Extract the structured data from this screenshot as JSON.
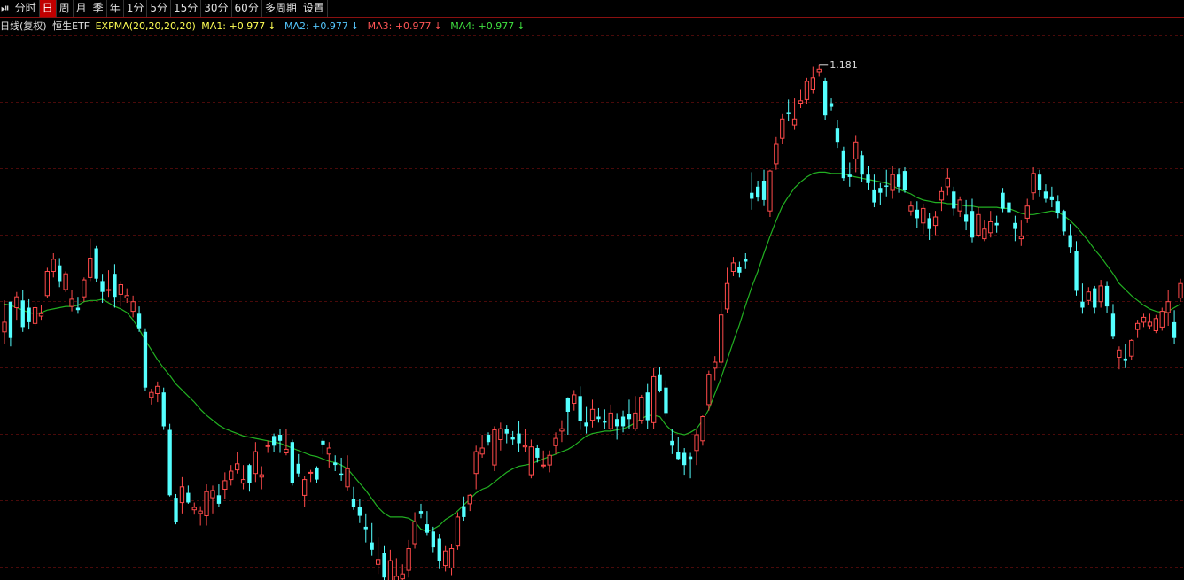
{
  "toolbar": {
    "items": [
      {
        "label": "⏯"
      },
      {
        "label": "分时"
      },
      {
        "label": "日"
      },
      {
        "label": "周"
      },
      {
        "label": "月"
      },
      {
        "label": "季"
      },
      {
        "label": "年"
      },
      {
        "label": "1分"
      },
      {
        "label": "5分"
      },
      {
        "label": "15分"
      },
      {
        "label": "30分"
      },
      {
        "label": "60分"
      },
      {
        "label": "多周期"
      },
      {
        "label": "设置"
      }
    ],
    "active_index": 2
  },
  "info": {
    "period": "日线(复权)",
    "symbol": "恒生ETF",
    "indicator": "EXPMA(20,20,20,20)",
    "ma1": "MA1: +0.977",
    "ma2": "MA2: +0.977",
    "ma3": "MA3: +0.977",
    "ma4": "MA4: +0.977",
    "arrow": "↓"
  },
  "colors": {
    "up": "#ff4a4a",
    "down": "#54ffff",
    "ema": "#22b022",
    "grid": "#4a0a0a",
    "ma1": "#ffff55",
    "ma2": "#55c8ff",
    "ma3": "#ff5555",
    "ma4": "#40e040",
    "indicator": "#ffff55"
  },
  "chart_data": {
    "type": "candlestick",
    "title": "",
    "ylim": [
      0.755,
      1.205
    ],
    "max_label": "1.181",
    "candles": [
      [
        0.96,
        0.986,
        0.95,
        0.968
      ],
      [
        0.985,
        0.985,
        0.948,
        0.955
      ],
      [
        0.98,
        0.993,
        0.97,
        0.989
      ],
      [
        0.986,
        0.995,
        0.96,
        0.964
      ],
      [
        0.98,
        0.987,
        0.962,
        0.968
      ],
      [
        0.967,
        0.985,
        0.965,
        0.98
      ],
      [
        0.973,
        0.982,
        0.97,
        0.975
      ],
      [
        0.99,
        1.013,
        0.988,
        1.01
      ],
      [
        1.01,
        1.025,
        1.005,
        1.02
      ],
      [
        1.015,
        1.021,
        0.997,
        1.002
      ],
      [
        0.995,
        1.01,
        0.993,
        1.008
      ],
      [
        0.981,
        0.995,
        0.977,
        0.987
      ],
      [
        0.98,
        0.989,
        0.975,
        0.978
      ],
      [
        0.989,
        1.005,
        0.985,
        1.003
      ],
      [
        1.005,
        1.037,
        1.002,
        1.021
      ],
      [
        1.029,
        1.031,
        1.001,
        1.004
      ],
      [
        1.002,
        1.008,
        0.984,
        0.993
      ],
      [
        0.995,
        1.011,
        0.989,
        0.995
      ],
      [
        1.008,
        1.016,
        0.98,
        0.989
      ],
      [
        0.991,
        1.002,
        0.981,
        0.999
      ],
      [
        0.988,
        0.996,
        0.984,
        0.99
      ],
      [
        0.977,
        0.99,
        0.972,
        0.985
      ],
      [
        0.975,
        0.981,
        0.96,
        0.963
      ],
      [
        0.96,
        0.963,
        0.911,
        0.914
      ],
      [
        0.906,
        0.913,
        0.9,
        0.91
      ],
      [
        0.909,
        0.919,
        0.902,
        0.915
      ],
      [
        0.91,
        0.914,
        0.879,
        0.882
      ],
      [
        0.879,
        0.884,
        0.824,
        0.825
      ],
      [
        0.823,
        0.826,
        0.801,
        0.803
      ],
      [
        0.819,
        0.84,
        0.81,
        0.832
      ],
      [
        0.827,
        0.833,
        0.818,
        0.819
      ],
      [
        0.813,
        0.819,
        0.809,
        0.815
      ],
      [
        0.81,
        0.816,
        0.8,
        0.812
      ],
      [
        0.808,
        0.834,
        0.8,
        0.828
      ],
      [
        0.823,
        0.833,
        0.81,
        0.829
      ],
      [
        0.825,
        0.834,
        0.815,
        0.818
      ],
      [
        0.83,
        0.844,
        0.822,
        0.837
      ],
      [
        0.838,
        0.85,
        0.833,
        0.845
      ],
      [
        0.846,
        0.861,
        0.843,
        0.851
      ],
      [
        0.835,
        0.85,
        0.83,
        0.838
      ],
      [
        0.85,
        0.851,
        0.828,
        0.835
      ],
      [
        0.843,
        0.869,
        0.836,
        0.861
      ],
      [
        0.84,
        0.849,
        0.83,
        0.842
      ],
      [
        0.866,
        0.87,
        0.86,
        0.866
      ],
      [
        0.874,
        0.876,
        0.861,
        0.866
      ],
      [
        0.875,
        0.88,
        0.86,
        0.87
      ],
      [
        0.86,
        0.88,
        0.858,
        0.863
      ],
      [
        0.869,
        0.871,
        0.833,
        0.835
      ],
      [
        0.851,
        0.859,
        0.84,
        0.843
      ],
      [
        0.825,
        0.841,
        0.815,
        0.838
      ],
      [
        0.844,
        0.846,
        0.836,
        0.844
      ],
      [
        0.848,
        0.849,
        0.835,
        0.838
      ],
      [
        0.87,
        0.872,
        0.859,
        0.867
      ],
      [
        0.859,
        0.869,
        0.848,
        0.864
      ],
      [
        0.852,
        0.858,
        0.845,
        0.85
      ],
      [
        0.843,
        0.856,
        0.837,
        0.842
      ],
      [
        0.832,
        0.858,
        0.829,
        0.847
      ],
      [
        0.822,
        0.832,
        0.813,
        0.815
      ],
      [
        0.815,
        0.822,
        0.802,
        0.808
      ],
      [
        0.799,
        0.81,
        0.786,
        0.797
      ],
      [
        0.786,
        0.802,
        0.775,
        0.78
      ],
      [
        0.768,
        0.79,
        0.76,
        0.772
      ],
      [
        0.777,
        0.783,
        0.748,
        0.757
      ],
      [
        0.752,
        0.78,
        0.745,
        0.771
      ],
      [
        0.746,
        0.773,
        0.74,
        0.758
      ],
      [
        0.756,
        0.768,
        0.745,
        0.76
      ],
      [
        0.763,
        0.788,
        0.757,
        0.781
      ],
      [
        0.785,
        0.811,
        0.781,
        0.803
      ],
      [
        0.812,
        0.818,
        0.806,
        0.81
      ],
      [
        0.801,
        0.812,
        0.792,
        0.794
      ],
      [
        0.795,
        0.799,
        0.778,
        0.782
      ],
      [
        0.789,
        0.793,
        0.764,
        0.771
      ],
      [
        0.767,
        0.783,
        0.762,
        0.779
      ],
      [
        0.765,
        0.785,
        0.759,
        0.781
      ],
      [
        0.783,
        0.811,
        0.78,
        0.807
      ],
      [
        0.816,
        0.824,
        0.804,
        0.807
      ],
      [
        0.818,
        0.826,
        0.812,
        0.825
      ],
      [
        0.843,
        0.866,
        0.83,
        0.861
      ],
      [
        0.859,
        0.875,
        0.856,
        0.864
      ],
      [
        0.875,
        0.877,
        0.866,
        0.869
      ],
      [
        0.85,
        0.882,
        0.845,
        0.879
      ],
      [
        0.871,
        0.885,
        0.862,
        0.88
      ],
      [
        0.88,
        0.883,
        0.868,
        0.876
      ],
      [
        0.873,
        0.878,
        0.867,
        0.871
      ],
      [
        0.876,
        0.886,
        0.861,
        0.868
      ],
      [
        0.865,
        0.88,
        0.861,
        0.866
      ],
      [
        0.842,
        0.871,
        0.839,
        0.865
      ],
      [
        0.864,
        0.867,
        0.852,
        0.856
      ],
      [
        0.85,
        0.862,
        0.847,
        0.85
      ],
      [
        0.85,
        0.862,
        0.844,
        0.858
      ],
      [
        0.866,
        0.877,
        0.859,
        0.872
      ],
      [
        0.878,
        0.887,
        0.869,
        0.88
      ],
      [
        0.905,
        0.906,
        0.875,
        0.894
      ],
      [
        0.901,
        0.912,
        0.895,
        0.908
      ],
      [
        0.907,
        0.915,
        0.879,
        0.886
      ],
      [
        0.885,
        0.898,
        0.876,
        0.882
      ],
      [
        0.887,
        0.904,
        0.881,
        0.896
      ],
      [
        0.89,
        0.897,
        0.885,
        0.888
      ],
      [
        0.886,
        0.896,
        0.88,
        0.885
      ],
      [
        0.88,
        0.9,
        0.878,
        0.893
      ],
      [
        0.888,
        0.893,
        0.871,
        0.882
      ],
      [
        0.89,
        0.895,
        0.877,
        0.882
      ],
      [
        0.892,
        0.904,
        0.88,
        0.888
      ],
      [
        0.88,
        0.907,
        0.878,
        0.893
      ],
      [
        0.887,
        0.908,
        0.884,
        0.906
      ],
      [
        0.91,
        0.917,
        0.88,
        0.887
      ],
      [
        0.885,
        0.93,
        0.88,
        0.923
      ],
      [
        0.925,
        0.931,
        0.91,
        0.911
      ],
      [
        0.914,
        0.92,
        0.89,
        0.893
      ],
      [
        0.87,
        0.88,
        0.859,
        0.866
      ],
      [
        0.861,
        0.873,
        0.854,
        0.855
      ],
      [
        0.86,
        0.864,
        0.842,
        0.85
      ],
      [
        0.857,
        0.86,
        0.839,
        0.855
      ],
      [
        0.862,
        0.879,
        0.85,
        0.875
      ],
      [
        0.87,
        0.891,
        0.866,
        0.89
      ],
      [
        0.9,
        0.928,
        0.895,
        0.925
      ],
      [
        0.93,
        0.94,
        0.92,
        0.935
      ],
      [
        0.935,
        0.985,
        0.932,
        0.974
      ],
      [
        0.979,
        1.013,
        0.976,
        1.0
      ],
      [
        1.01,
        1.022,
        1.006,
        1.017
      ],
      [
        1.014,
        1.018,
        1.005,
        1.009
      ],
      [
        1.02,
        1.025,
        1.012,
        1.018
      ],
      [
        1.075,
        1.092,
        1.061,
        1.07
      ],
      [
        1.08,
        1.085,
        1.068,
        1.071
      ],
      [
        1.085,
        1.094,
        1.064,
        1.069
      ],
      [
        1.06,
        1.094,
        1.055,
        1.093
      ],
      [
        1.099,
        1.121,
        1.094,
        1.115
      ],
      [
        1.12,
        1.14,
        1.115,
        1.136
      ],
      [
        1.141,
        1.152,
        1.134,
        1.14
      ],
      [
        1.131,
        1.153,
        1.127,
        1.136
      ],
      [
        1.149,
        1.16,
        1.145,
        1.151
      ],
      [
        1.152,
        1.17,
        1.148,
        1.167
      ],
      [
        1.16,
        1.179,
        1.157,
        1.17
      ],
      [
        1.175,
        1.181,
        1.171,
        1.177
      ],
      [
        1.167,
        1.17,
        1.135,
        1.139
      ],
      [
        1.149,
        1.153,
        1.143,
        1.146
      ],
      [
        1.128,
        1.135,
        1.112,
        1.117
      ],
      [
        1.11,
        1.113,
        1.085,
        1.087
      ],
      [
        1.09,
        1.1,
        1.08,
        1.088
      ],
      [
        1.103,
        1.122,
        1.092,
        1.117
      ],
      [
        1.106,
        1.11,
        1.084,
        1.09
      ],
      [
        1.09,
        1.097,
        1.077,
        1.083
      ],
      [
        1.077,
        1.09,
        1.063,
        1.067
      ],
      [
        1.079,
        1.083,
        1.065,
        1.075
      ],
      [
        1.081,
        1.094,
        1.072,
        1.08
      ],
      [
        1.077,
        1.097,
        1.07,
        1.09
      ],
      [
        1.09,
        1.095,
        1.075,
        1.08
      ],
      [
        1.093,
        1.096,
        1.075,
        1.077
      ],
      [
        1.06,
        1.068,
        1.056,
        1.064
      ],
      [
        1.061,
        1.068,
        1.046,
        1.054
      ],
      [
        1.05,
        1.066,
        1.041,
        1.062
      ],
      [
        1.054,
        1.058,
        1.036,
        1.045
      ],
      [
        1.048,
        1.06,
        1.04,
        1.055
      ],
      [
        1.069,
        1.08,
        1.06,
        1.076
      ],
      [
        1.08,
        1.095,
        1.073,
        1.087
      ],
      [
        1.076,
        1.08,
        1.056,
        1.062
      ],
      [
        1.06,
        1.072,
        1.055,
        1.069
      ],
      [
        1.057,
        1.069,
        1.044,
        1.051
      ],
      [
        1.06,
        1.07,
        1.034,
        1.038
      ],
      [
        1.04,
        1.063,
        1.038,
        1.057
      ],
      [
        1.037,
        1.052,
        1.035,
        1.045
      ],
      [
        1.042,
        1.06,
        1.038,
        1.051
      ],
      [
        1.05,
        1.056,
        1.042,
        1.048
      ],
      [
        1.075,
        1.079,
        1.059,
        1.062
      ],
      [
        1.067,
        1.071,
        1.055,
        1.059
      ],
      [
        1.05,
        1.056,
        1.035,
        1.045
      ],
      [
        1.037,
        1.052,
        1.031,
        1.039
      ],
      [
        1.054,
        1.07,
        1.05,
        1.064
      ],
      [
        1.075,
        1.096,
        1.069,
        1.091
      ],
      [
        1.09,
        1.094,
        1.072,
        1.077
      ],
      [
        1.076,
        1.082,
        1.067,
        1.07
      ],
      [
        1.072,
        1.08,
        1.063,
        1.069
      ],
      [
        1.068,
        1.073,
        1.054,
        1.058
      ],
      [
        1.06,
        1.061,
        1.04,
        1.043
      ],
      [
        1.04,
        1.049,
        1.025,
        1.03
      ],
      [
        1.027,
        1.035,
        0.99,
        0.994
      ],
      [
        0.985,
        1.0,
        0.975,
        0.98
      ],
      [
        0.986,
        0.997,
        0.982,
        0.993
      ],
      [
        0.996,
        0.998,
        0.975,
        0.98
      ],
      [
        0.985,
        1.003,
        0.98,
        0.998
      ],
      [
        0.998,
        1.002,
        0.976,
        0.981
      ],
      [
        0.975,
        0.983,
        0.954,
        0.956
      ],
      [
        0.939,
        0.948,
        0.929,
        0.945
      ],
      [
        0.938,
        0.95,
        0.93,
        0.936
      ],
      [
        0.94,
        0.954,
        0.937,
        0.953
      ],
      [
        0.962,
        0.97,
        0.955,
        0.967
      ],
      [
        0.968,
        0.975,
        0.964,
        0.972
      ],
      [
        0.965,
        0.975,
        0.962,
        0.968
      ],
      [
        0.961,
        0.974,
        0.959,
        0.971
      ],
      [
        0.964,
        0.98,
        0.961,
        0.977
      ],
      [
        0.976,
        0.995,
        0.965,
        0.985
      ],
      [
        0.968,
        0.978,
        0.95,
        0.955
      ],
      [
        0.988,
        1.004,
        0.985,
        1.0
      ]
    ],
    "ema": [
      0.983,
      0.982,
      0.98,
      0.978,
      0.976,
      0.975,
      0.976,
      0.978,
      0.979,
      0.98,
      0.981,
      0.981,
      0.982,
      0.985,
      0.986,
      0.986,
      0.987,
      0.984,
      0.981,
      0.979,
      0.976,
      0.97,
      0.962,
      0.953,
      0.945,
      0.937,
      0.93,
      0.924,
      0.917,
      0.912,
      0.907,
      0.902,
      0.896,
      0.891,
      0.887,
      0.883,
      0.88,
      0.878,
      0.876,
      0.874,
      0.873,
      0.872,
      0.871,
      0.87,
      0.869,
      0.868,
      0.866,
      0.864,
      0.862,
      0.86,
      0.858,
      0.857,
      0.855,
      0.853,
      0.852,
      0.85,
      0.847,
      0.841,
      0.835,
      0.829,
      0.822,
      0.815,
      0.81,
      0.807,
      0.807,
      0.807,
      0.806,
      0.803,
      0.797,
      0.795,
      0.797,
      0.8,
      0.805,
      0.808,
      0.812,
      0.817,
      0.822,
      0.827,
      0.83,
      0.832,
      0.836,
      0.84,
      0.844,
      0.847,
      0.849,
      0.85,
      0.851,
      0.853,
      0.855,
      0.857,
      0.859,
      0.861,
      0.863,
      0.866,
      0.87,
      0.874,
      0.876,
      0.877,
      0.878,
      0.878,
      0.879,
      0.88,
      0.882,
      0.885,
      0.888,
      0.891,
      0.891,
      0.89,
      0.883,
      0.878,
      0.876,
      0.875,
      0.877,
      0.88,
      0.887,
      0.896,
      0.909,
      0.922,
      0.937,
      0.952,
      0.966,
      0.982,
      0.997,
      1.01,
      1.025,
      1.039,
      1.052,
      1.064,
      1.072,
      1.079,
      1.084,
      1.088,
      1.091,
      1.092,
      1.092,
      1.091,
      1.091,
      1.091,
      1.089,
      1.088,
      1.087,
      1.086,
      1.085,
      1.084,
      1.083,
      1.081,
      1.078,
      1.076,
      1.074,
      1.071,
      1.069,
      1.068,
      1.067,
      1.067,
      1.066,
      1.066,
      1.065,
      1.064,
      1.064,
      1.063,
      1.063,
      1.063,
      1.063,
      1.062,
      1.062,
      1.06,
      1.058,
      1.057,
      1.057,
      1.058,
      1.059,
      1.06,
      1.059,
      1.056,
      1.052,
      1.047,
      1.041,
      1.035,
      1.028,
      1.022,
      1.015,
      1.008,
      1.0,
      0.995,
      0.99,
      0.986,
      0.982,
      0.979,
      0.977,
      0.976,
      0.977,
      0.98,
      0.983
    ]
  }
}
